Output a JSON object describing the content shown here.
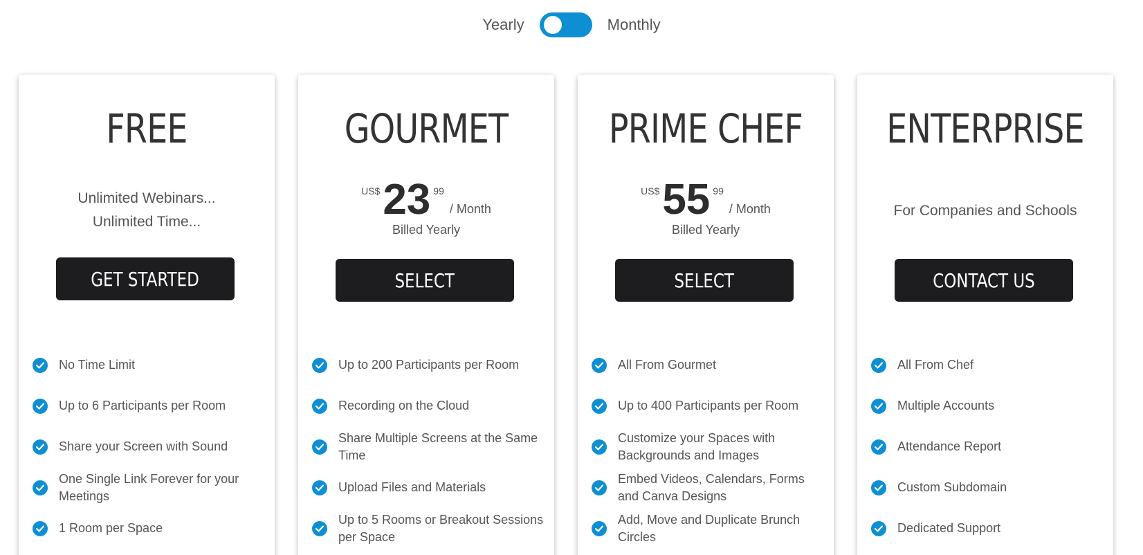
{
  "billing": {
    "yearly_label": "Yearly",
    "monthly_label": "Monthly"
  },
  "colors": {
    "accent": "#0e8fd3",
    "button": "#1d1d1f"
  },
  "plans": [
    {
      "name": "FREE",
      "tagline_lines": [
        "Unlimited Webinars...",
        "Unlimited Time..."
      ],
      "button": "GET STARTED",
      "features": [
        "No Time Limit",
        "Up to 6 Participants per Room",
        "Share your Screen with Sound",
        "One Single Link Forever for your Meetings",
        "1 Room per Space"
      ]
    },
    {
      "name": "GOURMET",
      "price": {
        "currency": "US$",
        "amount": "23",
        "cents": "99",
        "period": "/ Month",
        "billed": "Billed Yearly"
      },
      "button": "SELECT",
      "features": [
        "Up to 200 Participants per Room",
        "Recording on the Cloud",
        "Share Multiple Screens at the Same Time",
        "Upload Files and Materials",
        "Up to 5 Rooms or Breakout Sessions per Space"
      ]
    },
    {
      "name": "PRIME CHEF",
      "price": {
        "currency": "US$",
        "amount": "55",
        "cents": "99",
        "period": "/ Month",
        "billed": "Billed Yearly"
      },
      "button": "SELECT",
      "features": [
        "All From Gourmet",
        "Up to 400 Participants per Room",
        "Customize your Spaces with Backgrounds and Images",
        "Embed Videos, Calendars, Forms and Canva Designs",
        "Add, Move and Duplicate Brunch Circles"
      ]
    },
    {
      "name": "ENTERPRISE",
      "tagline": "For Companies and Schools",
      "button": "CONTACT US",
      "features": [
        "All From Chef",
        "Multiple Accounts",
        "Attendance Report",
        "Custom Subdomain",
        "Dedicated Support"
      ]
    }
  ]
}
